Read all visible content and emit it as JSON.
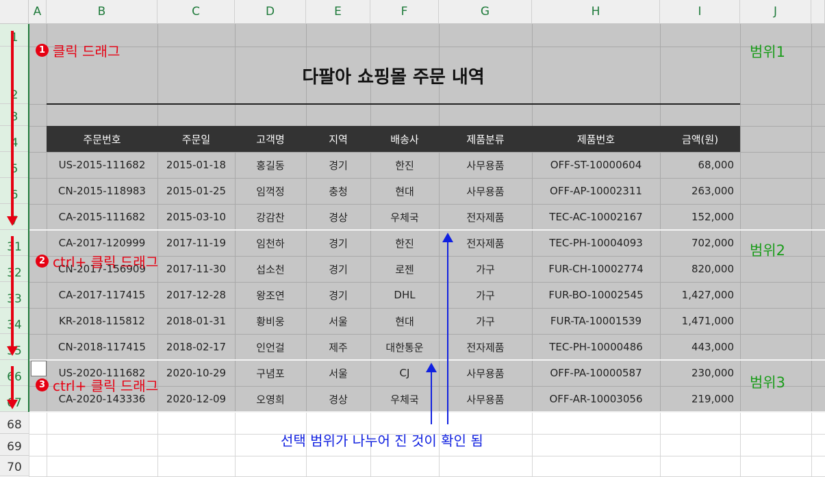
{
  "columns": [
    "A",
    "B",
    "C",
    "D",
    "E",
    "F",
    "G",
    "H",
    "I",
    "J"
  ],
  "rows": [
    {
      "label": "1",
      "selected": true
    },
    {
      "label": "2",
      "selected": true
    },
    {
      "label": "3",
      "selected": true
    },
    {
      "label": "4",
      "selected": true
    },
    {
      "label": "5",
      "selected": true
    },
    {
      "label": "6",
      "selected": true
    },
    {
      "label": "7",
      "selected": true
    },
    {
      "label": "31",
      "selected": true
    },
    {
      "label": "32",
      "selected": true
    },
    {
      "label": "33",
      "selected": true
    },
    {
      "label": "34",
      "selected": true
    },
    {
      "label": "35",
      "selected": true
    },
    {
      "label": "66",
      "selected": true
    },
    {
      "label": "67",
      "selected": true
    },
    {
      "label": "68",
      "selected": false
    },
    {
      "label": "69",
      "selected": false
    },
    {
      "label": "70",
      "selected": false
    }
  ],
  "sheet_title": "다팔아 쇼핑몰 주문 내역",
  "table_headers": [
    "주문번호",
    "주문일",
    "고객명",
    "지역",
    "배송사",
    "제품분류",
    "제품번호",
    "금액(원)"
  ],
  "table_rows": [
    [
      "US-2015-111682",
      "2015-01-18",
      "홍길동",
      "경기",
      "한진",
      "사무용품",
      "OFF-ST-10000604",
      "68,000"
    ],
    [
      "CN-2015-118983",
      "2015-01-25",
      "임꺽정",
      "충청",
      "현대",
      "사무용품",
      "OFF-AP-10002311",
      "263,000"
    ],
    [
      "CA-2015-111682",
      "2015-03-10",
      "강감찬",
      "경상",
      "우체국",
      "전자제품",
      "TEC-AC-10002167",
      "152,000"
    ],
    [
      "CA-2017-120999",
      "2017-11-19",
      "임천하",
      "경기",
      "한진",
      "전자제품",
      "TEC-PH-10004093",
      "702,000"
    ],
    [
      "CN-2017-156909",
      "2017-11-30",
      "섭소천",
      "경기",
      "로젠",
      "가구",
      "FUR-CH-10002774",
      "820,000"
    ],
    [
      "CA-2017-117415",
      "2017-12-28",
      "왕조연",
      "경기",
      "DHL",
      "가구",
      "FUR-BO-10002545",
      "1,427,000"
    ],
    [
      "KR-2018-115812",
      "2018-01-31",
      "황비웅",
      "서울",
      "현대",
      "가구",
      "FUR-TA-10001539",
      "1,471,000"
    ],
    [
      "CN-2018-117415",
      "2018-02-17",
      "인언걸",
      "제주",
      "대한통운",
      "전자제품",
      "TEC-PH-10000486",
      "443,000"
    ],
    [
      "US-2020-111682",
      "2020-10-29",
      "구념포",
      "서울",
      "CJ",
      "사무용품",
      "OFF-PA-10000587",
      "230,000"
    ],
    [
      "CA-2020-143336",
      "2020-12-09",
      "오영희",
      "경상",
      "우체국",
      "사무용품",
      "OFF-AR-10003056",
      "219,000"
    ]
  ],
  "annotations": {
    "step1": {
      "num": "1",
      "text": "클릭 드래그"
    },
    "step2": {
      "num": "2",
      "text": "ctrl+ 클릭 드래그"
    },
    "step3": {
      "num": "3",
      "text": "ctrl+ 클릭 드래그"
    },
    "range1": "범위1",
    "range2": "범위2",
    "range3": "범위3",
    "note": "선택 범위가 나누어 진 것이 확인 됨"
  },
  "colors": {
    "selection": "#c6c6c6",
    "header_fill": "#333333",
    "annotation_red": "#e60012",
    "range_green": "#1a9c1a",
    "note_blue": "#1020e0",
    "row_header_selected": "#dff0e2"
  }
}
